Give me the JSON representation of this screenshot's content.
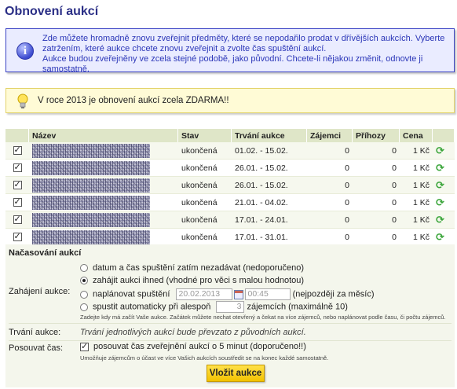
{
  "page_title": "Obnovení aukcí",
  "info": {
    "icon": "info-icon",
    "lines": [
      "Zde můžete hromadně znovu zveřejnit předměty, které se nepodařilo prodat v dřívějších aukcích. Vyberte",
      "zatržením, které aukce chcete znovu zveřejnit a zvolte čas spuštění aukcí.",
      "Aukce budou zveřejněny ve zcela stejné podobě, jako původní. Chcete-li nějakou změnit, odnovte ji samostatně."
    ]
  },
  "tip": {
    "icon": "lightbulb-icon",
    "text": "V roce 2013 je obnovení aukcí zcela ZDARMA!!"
  },
  "table": {
    "headers": [
      "",
      "Název",
      "Stav",
      "Trvání aukce",
      "Zájemci",
      "Příhozy",
      "Cena",
      ""
    ],
    "rows": [
      {
        "checked": true,
        "status": "ukončená",
        "duration": "01.02. - 15.02.",
        "interested": "0",
        "bids": "0",
        "price": "1 Kč"
      },
      {
        "checked": true,
        "status": "ukončená",
        "duration": "26.01. - 15.02.",
        "interested": "0",
        "bids": "0",
        "price": "1 Kč"
      },
      {
        "checked": true,
        "status": "ukončená",
        "duration": "26.01. - 15.02.",
        "interested": "0",
        "bids": "0",
        "price": "1 Kč"
      },
      {
        "checked": true,
        "status": "ukončená",
        "duration": "21.01. - 04.02.",
        "interested": "0",
        "bids": "0",
        "price": "1 Kč"
      },
      {
        "checked": true,
        "status": "ukončená",
        "duration": "17.01. - 24.01.",
        "interested": "0",
        "bids": "0",
        "price": "1 Kč"
      },
      {
        "checked": true,
        "status": "ukončená",
        "duration": "17.01. - 31.01.",
        "interested": "0",
        "bids": "0",
        "price": "1 Kč"
      }
    ]
  },
  "settings": {
    "heading": "Načasování aukcí",
    "start_label": "Zahájení aukce:",
    "options": {
      "later": "datum a čas spuštění zatím nezadávat (nedoporučeno)",
      "now": "zahájit aukci ihned (vhodné pro věci s malou hodnotou)",
      "planned": "naplánovat spuštění",
      "planned_date": "20.02.2013",
      "planned_time": "00:45",
      "planned_note": "(nejpozději za měsíc)",
      "auto_prefix": "spustit automaticky při alespoň",
      "auto_value": "3",
      "auto_suffix": "zájemcích (maximálně 10)"
    },
    "start_hint": "Zadejte kdy má začít Vaše aukce. Začátek můžete nechat otevřený a čekat na více zájemců, nebo naplánovat podle času, či počtu zájemců.",
    "duration_label": "Trvání aukce:",
    "duration_text": "Trvání jednotlivých aukcí bude převzato z původních aukcí.",
    "shift_label": "Posouvat čas:",
    "shift_option": "posouvat čas zveřejnění aukcí o 5 minut (doporučeno!!)",
    "shift_hint": "Umožňuje zájemcům o účast ve více Vašich aukcích soustředit se na konec každé samostatně.",
    "submit_label": "Vložit aukce"
  }
}
